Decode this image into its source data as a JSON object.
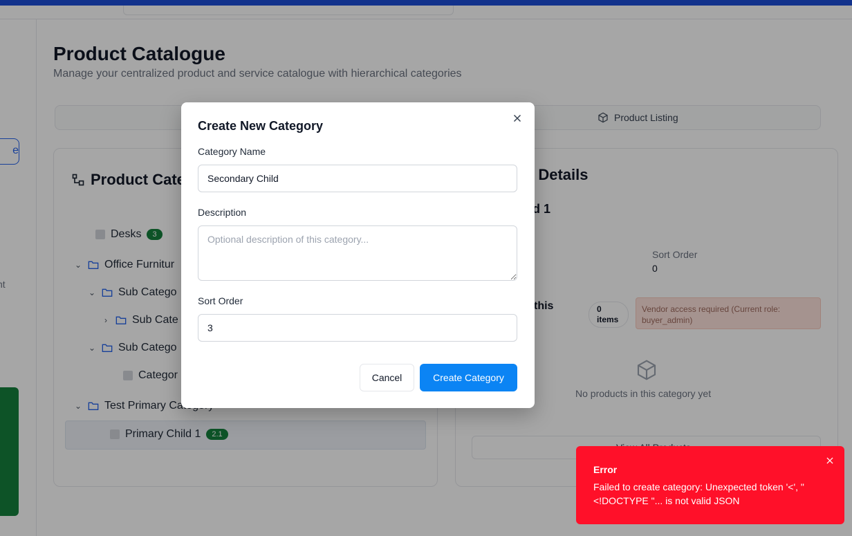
{
  "page": {
    "title": "Product Catalogue",
    "subtitle": "Manage your centralized product and service catalogue with hierarchical categories"
  },
  "sidebar": {
    "pill_text": "e",
    "text1": "t",
    "text2": "nt"
  },
  "tabs": {
    "listing_label": "Product Listing"
  },
  "left_panel": {
    "title": "Product Cate",
    "tree": [
      {
        "label": "Desks",
        "badge": "3"
      },
      {
        "label": "Office Furnitur"
      },
      {
        "label": "Sub Catego"
      },
      {
        "label": "Sub Cate"
      },
      {
        "label": "Sub Catego"
      },
      {
        "label": "Categor"
      },
      {
        "label": "Test Primary Category"
      },
      {
        "label": "Primary Child 1",
        "badge": "2.1"
      }
    ]
  },
  "right_panel": {
    "title": "y Details",
    "name": "ild 1",
    "sort_label": "Sort Order",
    "sort_value": "0",
    "this_label": "this",
    "items_count": "0",
    "items_word": "items",
    "vendor_note": "Vendor access required (Current role: buyer_admin)",
    "no_products": "No products in this category yet",
    "view_all": "View All Products"
  },
  "modal": {
    "title": "Create New Category",
    "name_label": "Category Name",
    "name_value": "Secondary Child",
    "description_label": "Description",
    "description_placeholder": "Optional description of this category...",
    "sort_label": "Sort Order",
    "sort_value": "3",
    "cancel_label": "Cancel",
    "create_label": "Create Category"
  },
  "toast": {
    "title": "Error",
    "message": "Failed to create category: Unexpected token '<', \"<!DOCTYPE \"... is not valid JSON"
  },
  "colors": {
    "primary": "#0b84f4",
    "error": "#ff1029",
    "badge": "#15803d",
    "topbar": "#1d4ed8"
  }
}
